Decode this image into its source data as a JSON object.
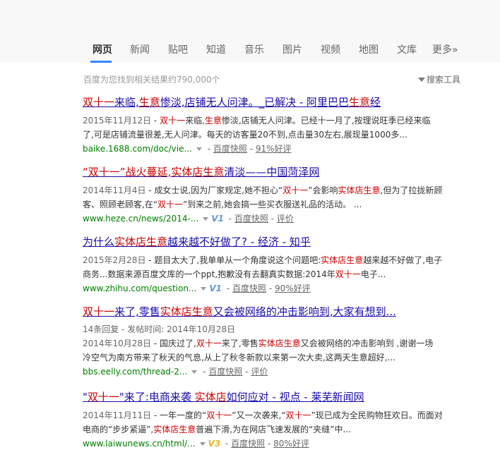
{
  "tabs": [
    "网页",
    "新闻",
    "贴吧",
    "知道",
    "音乐",
    "图片",
    "视频",
    "地图",
    "文库",
    "更多»"
  ],
  "stats": "百度为您找到相关结果约790,000个",
  "tools": "搜索工具",
  "results": [
    {
      "title": [
        "双十一",
        "来临,",
        "生意",
        "惨淡,店铺无人问津。_已解决 - 阿里巴巴",
        "生意",
        "经"
      ],
      "abstract": [
        {
          "date": "2015年11月12日",
          "text": [
            " - ",
            "双十一",
            "来临,",
            "生意",
            "惨淡,店铺无人问津。已经十一月了,按理说旺季已经来临"
          ]
        },
        {
          "text": [
            "了,可是店铺流量很差,无人问津。每天的访客量20不到,点击量30左右,展现量1000多..."
          ]
        }
      ],
      "url": "baike.1688.com/doc/vie...",
      "badge": "",
      "snapshot": "百度快照",
      "rating": "91%好评"
    },
    {
      "title": [
        "“双十一”",
        "战火蔓延,",
        "实体店生意",
        "清淡——中国菏泽网"
      ],
      "abstract": [
        {
          "date": "2014年11月4日",
          "text": [
            " - 成女士说,因为厂家规定,她不担心“",
            "双十一",
            "”会影响",
            "实体店生意",
            ",但为了拉拢新顾"
          ]
        },
        {
          "text": [
            "客、照顾老顾客,在“",
            "双十一",
            "”到来之前,她会搞一些买衣服送礼品的活动。 ..."
          ]
        }
      ],
      "url": "www.heze.cn/news/2014-...",
      "badge": "V1",
      "snapshot": "百度快照",
      "rating": "评价"
    },
    {
      "title": [
        "为什么",
        "实体店生意",
        "越来越不好做了? - 经济 - 知乎"
      ],
      "abstract": [
        {
          "date": "2015年2月28日",
          "text": [
            " - 题目太大了,我单单从一个角度说这个问题吧:",
            "实体店生意",
            "越来越不好做了,电子"
          ]
        },
        {
          "text": [
            "商务...数据来源百度文库的一个ppt,抱歉没有去翻真实数据:2014年",
            "双十一",
            "电子..."
          ]
        }
      ],
      "url": "www.zhihu.com/question...",
      "badge": "V1",
      "snapshot": "百度快照",
      "rating": "90%好评"
    },
    {
      "title": [
        "双十一",
        "来了,零售",
        "实体店生意",
        "又会被网络的冲击影响到,大家有想到..."
      ],
      "extra": "14条回复 - 发帖时间: 2014年10月28日",
      "abstract": [
        {
          "date": "2014年10月28日",
          "text": [
            " - 国庆过了,",
            "双十一",
            "来了,零售",
            "实体店生意",
            "又会被网络的冲击影响到 ,谢谢一场"
          ]
        },
        {
          "text": [
            "冷空气为南方带来了秋天的气息,从上了秋冬新款以来第一次大卖,这两天生意超好,..."
          ]
        }
      ],
      "url": "bbs.eelly.com/thread-2...",
      "badge": "",
      "snapshot": "百度快照",
      "rating": "评价"
    },
    {
      "title": [
        "\"",
        "双十一",
        "\"来了:电商来袭 ",
        "实体店",
        "如何应对 - 视点 - 莱芜新闻网"
      ],
      "abstract": [
        {
          "date": "2014年11月11日",
          "text": [
            " - 一年一度的“",
            "双十一",
            "”又一次袭来,“",
            "双十一",
            "”现已成为全民购物狂欢日。而面对"
          ]
        },
        {
          "text": [
            "电商的“步步紧逼”,",
            "实体店生意",
            "普遍下滑,为在网店飞速发展的“夹缝”中..."
          ]
        }
      ],
      "url": "www.laiwunews.cn/html/...",
      "badge": "V3",
      "snapshot": "百度快照",
      "rating": "80%好评"
    }
  ]
}
